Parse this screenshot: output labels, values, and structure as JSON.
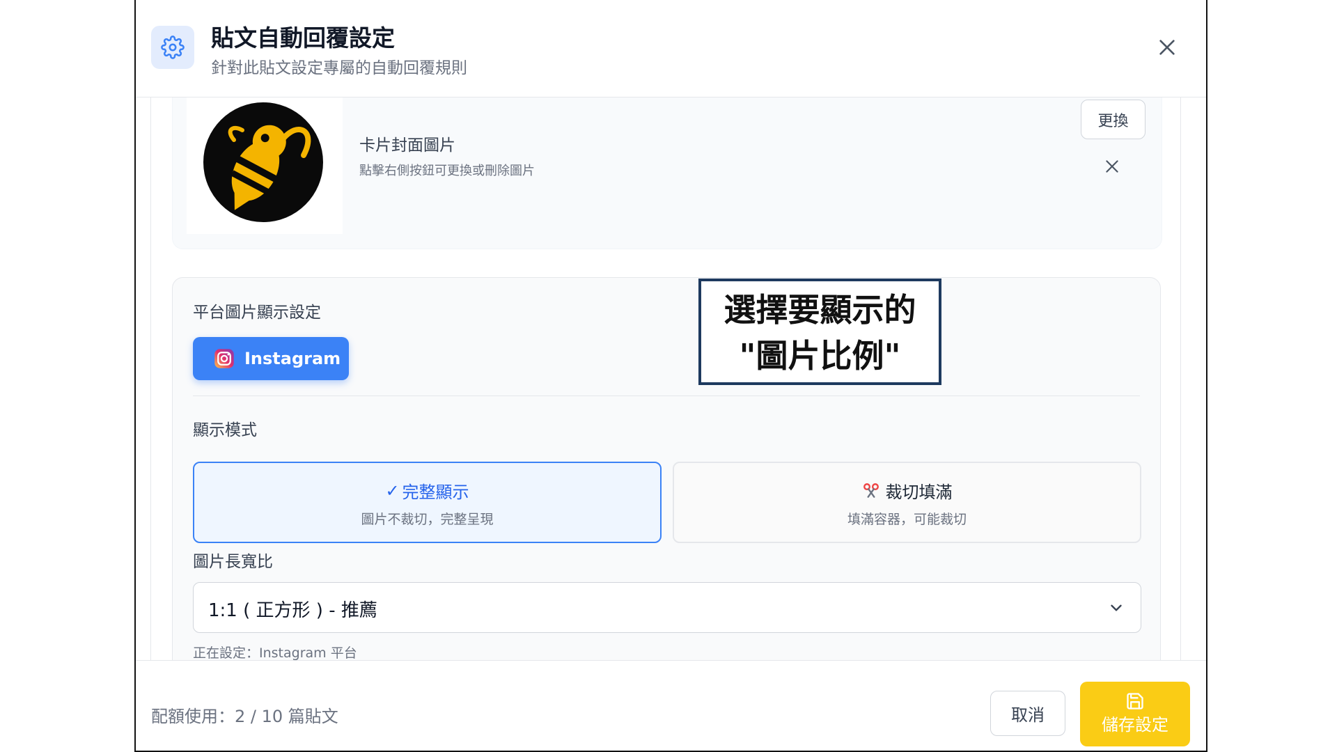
{
  "header": {
    "title": "貼文自動回覆設定",
    "subtitle": "針對此貼文設定專屬的自動回覆規則"
  },
  "cover": {
    "label": "卡片封面圖片",
    "hint": "點擊右側按鈕可更換或刪除圖片",
    "replace_label": "更換"
  },
  "platform": {
    "label": "平台圖片顯示設定",
    "selected": "Instagram"
  },
  "display_mode": {
    "label": "顯示模式",
    "options": [
      {
        "title": "完整顯示",
        "check": "✓",
        "desc": "圖片不裁切，完整呈現",
        "selected": true
      },
      {
        "title": "裁切填滿",
        "desc": "填滿容器，可能裁切",
        "selected": false
      }
    ]
  },
  "aspect_ratio": {
    "label": "圖片長寬比",
    "value": "1:1 ( 正方形 ) - 推薦",
    "now_setting": "正在設定：Instagram 平台"
  },
  "callout": {
    "line1": "選擇要顯示的",
    "line2": "\"圖片比例\""
  },
  "footer": {
    "quota": "配額使用：2 / 10 篇貼文",
    "cancel_label": "取消",
    "save_label": "儲存設定"
  },
  "colors": {
    "accent_blue": "#3b82f6",
    "save_yellow": "#facc15",
    "callout_border": "#1e3a5f"
  }
}
